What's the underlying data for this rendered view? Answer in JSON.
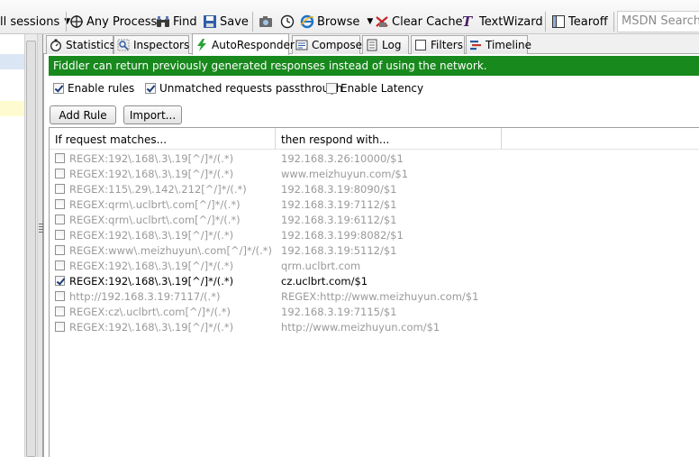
{
  "toolbar": {
    "sessions_label": "ll sessions",
    "any_process_label": "Any Process",
    "find_label": "Find",
    "save_label": "Save",
    "browse_label": "Browse",
    "clear_cache_label": "Clear Cache",
    "textwizard_label": "TextWizard",
    "tearoff_label": "Tearoff",
    "search_placeholder": "MSDN Search..."
  },
  "tabs": [
    {
      "label": "Statistics",
      "icon": "stopwatch-icon"
    },
    {
      "label": "Inspectors",
      "icon": "inspect-icon"
    },
    {
      "label": "AutoResponder",
      "icon": "lightning-icon",
      "active": true
    },
    {
      "label": "Composer",
      "icon": "composer-icon"
    },
    {
      "label": "Log",
      "icon": "log-icon"
    },
    {
      "label": "Filters",
      "icon": "filter-checkbox-icon"
    },
    {
      "label": "Timeline",
      "icon": "timeline-icon"
    }
  ],
  "autoresponder": {
    "banner": "Fiddler can return previously generated responses instead of using the network.",
    "enable_rules": {
      "label": "Enable rules",
      "checked": true
    },
    "passthrough": {
      "label": "Unmatched requests passthrough",
      "checked": true
    },
    "latency": {
      "label": "Enable Latency",
      "checked": false
    },
    "add_rule_label": "Add Rule",
    "import_label": "Import...",
    "col_match": "If request matches...",
    "col_respond": "then respond with...",
    "rules": [
      {
        "match": "REGEX:192\\.168\\.3\\.19[^/]*/(.*)",
        "respond": "192.168.3.26:10000/$1",
        "enabled": false
      },
      {
        "match": "REGEX:192\\.168\\.3\\.19[^/]*/(.*)",
        "respond": "www.meizhuyun.com/$1",
        "enabled": false
      },
      {
        "match": "REGEX:115\\.29\\.142\\.212[^/]*/(.*)",
        "respond": "192.168.3.19:8090/$1",
        "enabled": false
      },
      {
        "match": "REGEX:qrm\\.uclbrt\\.com[^/]*/(.*)",
        "respond": "192.168.3.19:7112/$1",
        "enabled": false
      },
      {
        "match": "REGEX:qrm\\.uclbrt\\.com[^/]*/(.*)",
        "respond": "192.168.3.19:6112/$1",
        "enabled": false
      },
      {
        "match": "REGEX:192\\.168\\.3\\.19[^/]*/(.*)",
        "respond": "192.168.3.199:8082/$1",
        "enabled": false
      },
      {
        "match": "REGEX:www\\.meizhuyun\\.com[^/]*/(.*)",
        "respond": "192.168.3.19:5112/$1",
        "enabled": false
      },
      {
        "match": "REGEX:192\\.168\\.3\\.19[^/]*/(.*)",
        "respond": "qrm.uclbrt.com",
        "enabled": false
      },
      {
        "match": "REGEX:192\\.168\\.3\\.19[^/]*/(.*)",
        "respond": "cz.uclbrt.com/$1",
        "enabled": true
      },
      {
        "match": "http://192.168.3.19:7117/(.*)",
        "respond": "REGEX:http://www.meizhuyun.com/$1",
        "enabled": false
      },
      {
        "match": "REGEX:cz\\.uclbrt\\.com[^/]*/(.*)",
        "respond": "192.168.3.19:7115/$1",
        "enabled": false
      },
      {
        "match": "REGEX:192\\.168\\.3\\.19[^/]*/(.*)",
        "respond": "http://www.meizhuyun.com/$1",
        "enabled": false
      }
    ]
  },
  "colors": {
    "banner_bg": "#18891c",
    "disabled_text": "#9a9a9a"
  }
}
